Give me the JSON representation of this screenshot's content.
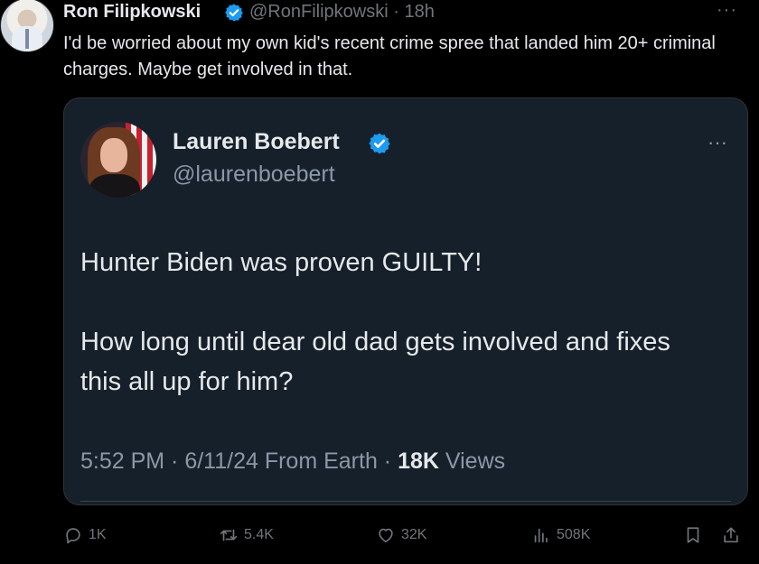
{
  "tweet": {
    "author_name": "Ron Filipkowski",
    "handle_time": "@RonFilipkowski · 18h",
    "more": "···",
    "text": "I'd be worried about my own kid's recent crime spree that landed him 20+ criminal charges. Maybe get involved in that."
  },
  "quote": {
    "author_name": "Lauren Boebert",
    "handle": "@laurenboebert",
    "more": "···",
    "paragraphs": [
      "Hunter Biden was proven GUILTY!",
      "How long until dear old dad gets involved and fixes this all up for him?"
    ],
    "meta_prefix": "5:52 PM · 6/11/24 From Earth · ",
    "views_count": "18K",
    "views_label": " Views"
  },
  "actions": {
    "replies": "1K",
    "retweets": "5.4K",
    "likes": "32K",
    "views": "508K"
  },
  "colors": {
    "background": "#000000",
    "quote_background": "#15202b",
    "verified": "#1d9bf0",
    "muted": "#71767b"
  }
}
